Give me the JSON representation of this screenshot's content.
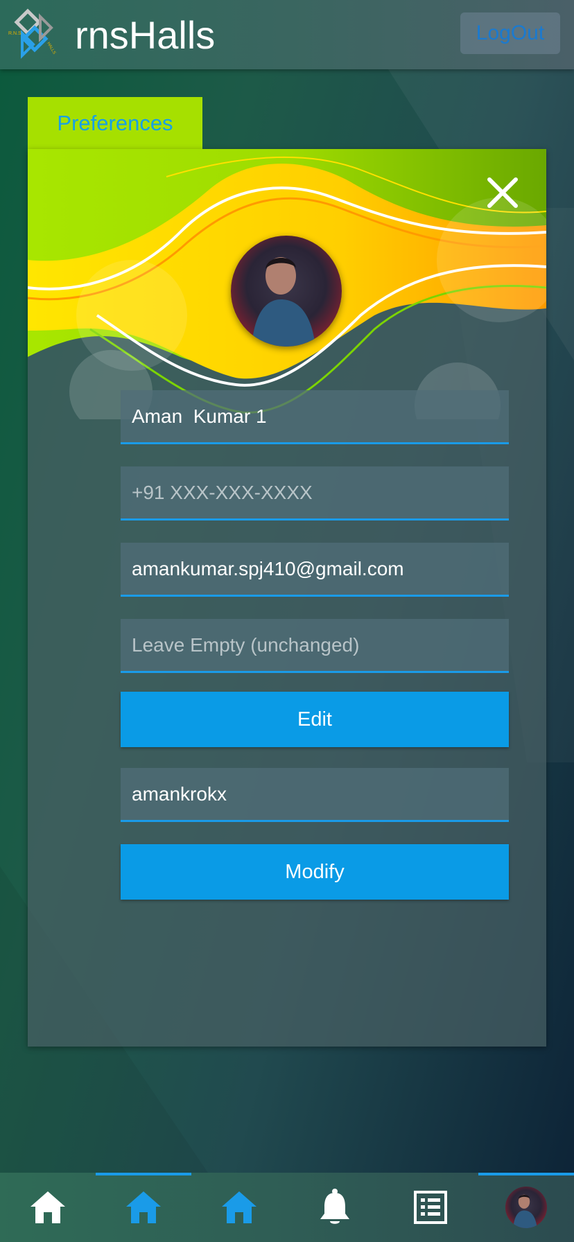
{
  "header": {
    "app_title": "rnsHalls",
    "logo_text": "R.N.S HALLS",
    "logout_label": "LogOut"
  },
  "card": {
    "tab_label": "Preferences",
    "fields": {
      "name": {
        "value": "Aman  Kumar 1",
        "placeholder": ""
      },
      "phone": {
        "value": "",
        "placeholder": "+91 XXX-XXX-XXXX"
      },
      "email": {
        "value": "amankumar.spj410@gmail.com",
        "placeholder": ""
      },
      "password": {
        "value": "",
        "placeholder": "Leave Empty (unchanged)"
      },
      "username": {
        "value": "amankrokx",
        "placeholder": ""
      }
    },
    "edit_label": "Edit",
    "modify_label": "Modify"
  },
  "bottom_nav": {
    "items": [
      {
        "icon": "home-icon",
        "color": "#ffffff",
        "active": false
      },
      {
        "icon": "home-icon",
        "color": "#1a9be8",
        "active": true
      },
      {
        "icon": "home-icon",
        "color": "#1a9be8",
        "active": false
      },
      {
        "icon": "bell-icon",
        "color": "#ffffff",
        "active": false
      },
      {
        "icon": "list-icon",
        "color": "#ffffff",
        "active": false
      },
      {
        "icon": "profile-avatar",
        "color": "",
        "active": true
      }
    ]
  },
  "colors": {
    "accent": "#1a9be8",
    "tab": "#a6e000",
    "button": "#0a9be6"
  }
}
